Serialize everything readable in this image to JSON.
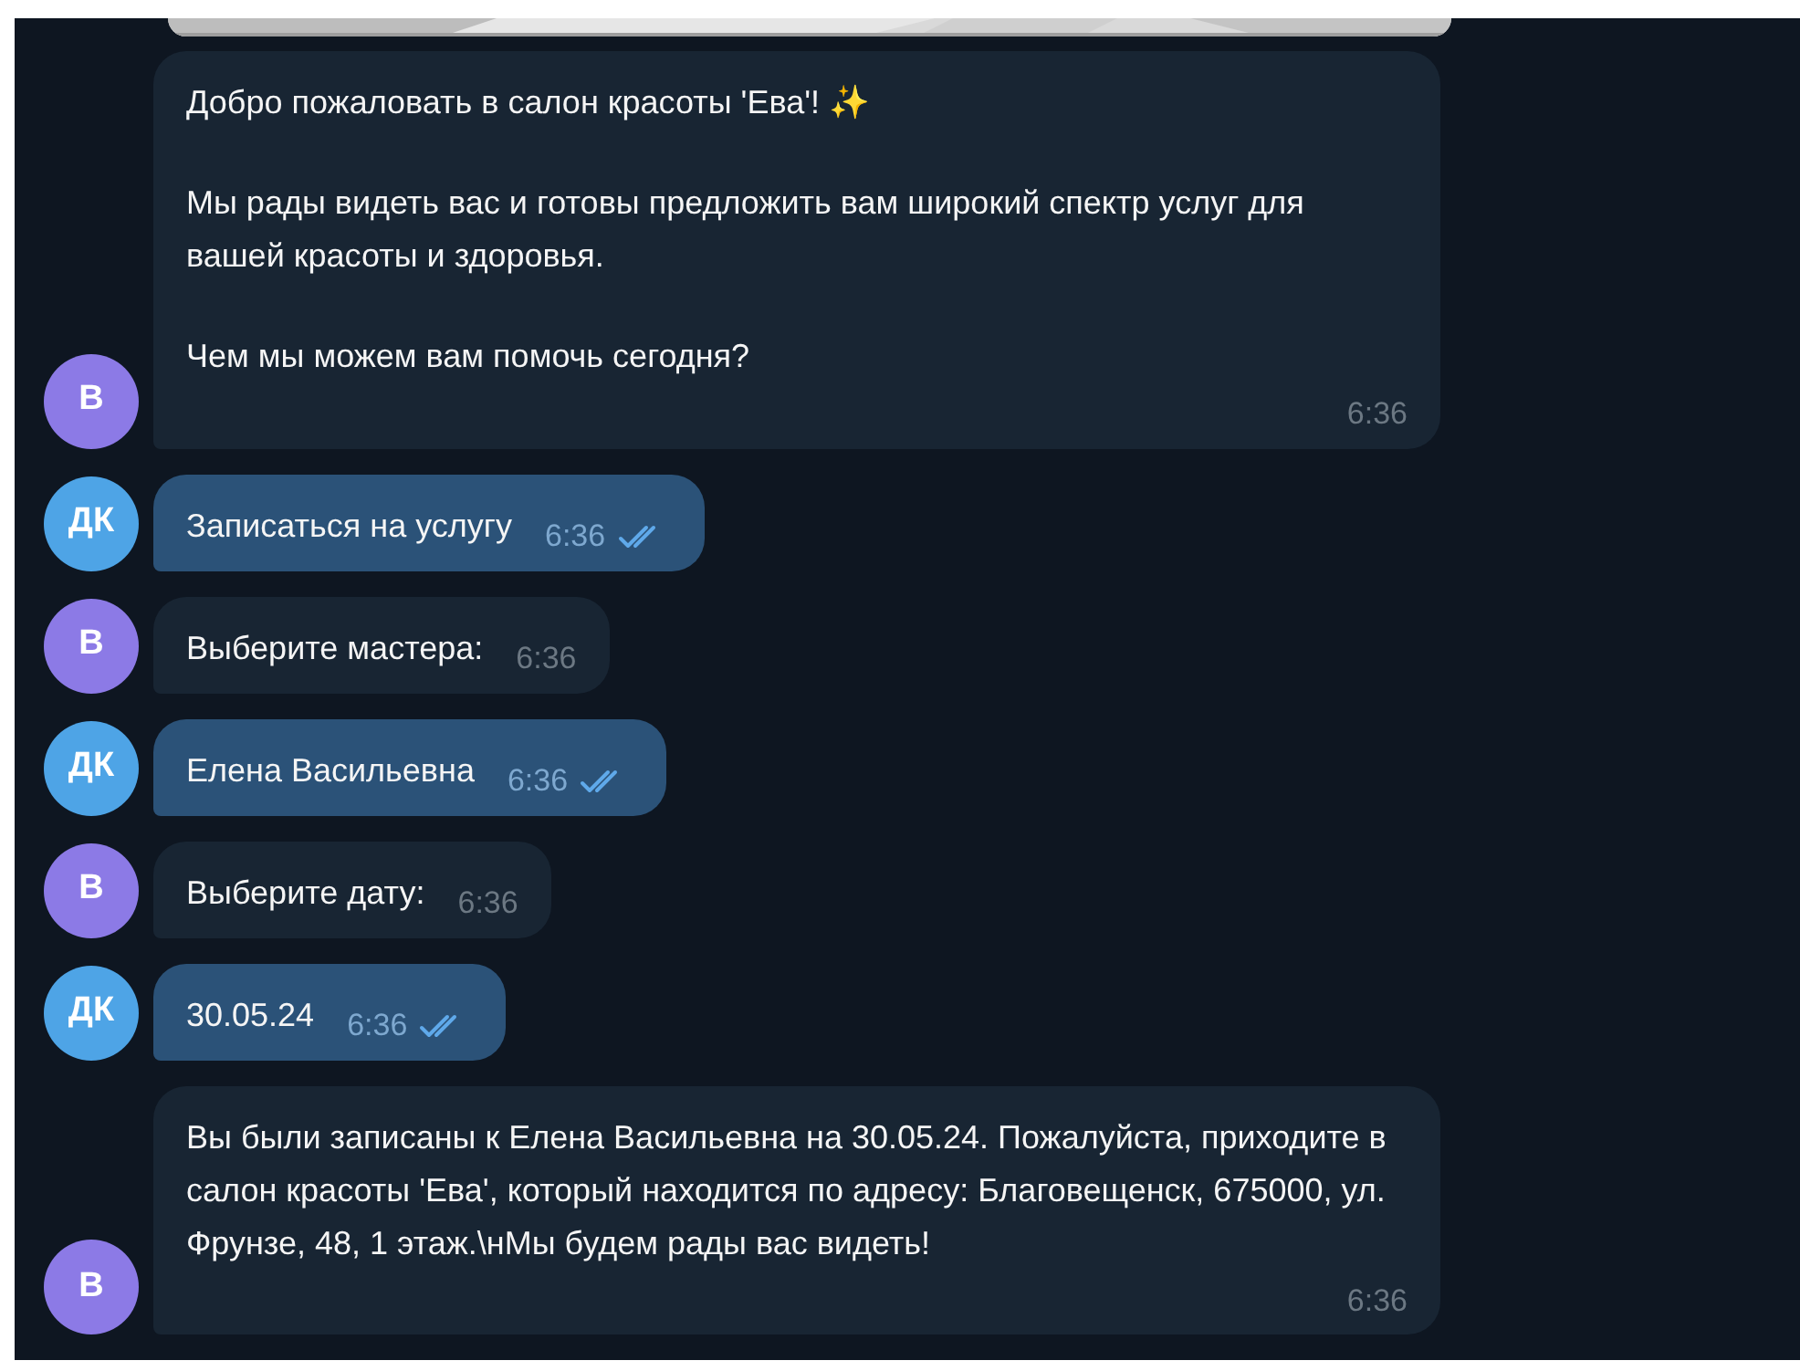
{
  "messages": [
    {
      "outgoing": false,
      "avatar": {
        "initials": "В",
        "color": "#8c7ae6"
      },
      "paragraphs": [
        "Добро пожаловать в салон красоты 'Ева'! ✨",
        "Мы рады видеть вас и готовы предложить вам широкий спектр услуг для вашей красоты и здоровья.",
        "Чем мы можем вам помочь сегодня?"
      ],
      "time": "6:36"
    },
    {
      "outgoing": true,
      "read": true,
      "avatar": {
        "initials": "ДК",
        "color": "#4ea4e6"
      },
      "paragraphs": [
        "Записаться на услугу"
      ],
      "time": "6:36"
    },
    {
      "outgoing": false,
      "avatar": {
        "initials": "В",
        "color": "#8c7ae6"
      },
      "paragraphs": [
        "Выберите мастера:"
      ],
      "time": "6:36"
    },
    {
      "outgoing": true,
      "read": true,
      "avatar": {
        "initials": "ДК",
        "color": "#4ea4e6"
      },
      "paragraphs": [
        "Елена Васильевна"
      ],
      "time": "6:36"
    },
    {
      "outgoing": false,
      "avatar": {
        "initials": "В",
        "color": "#8c7ae6"
      },
      "paragraphs": [
        "Выберите дату:"
      ],
      "time": "6:36"
    },
    {
      "outgoing": true,
      "read": true,
      "avatar": {
        "initials": "ДК",
        "color": "#4ea4e6"
      },
      "paragraphs": [
        "30.05.24"
      ],
      "time": "6:36"
    },
    {
      "outgoing": false,
      "avatar": {
        "initials": "В",
        "color": "#8c7ae6"
      },
      "paragraphs": [
        "Вы были записаны к Елена Васильевна на 30.05.24. Пожалуйста, приходите в салон красоты 'Ева', который находится по адресу: Благовещенск, 675000, ул. Фрунзе, 48, 1 этаж.\\нМы будем рады вас видеть!"
      ],
      "time": "6:36"
    }
  ]
}
